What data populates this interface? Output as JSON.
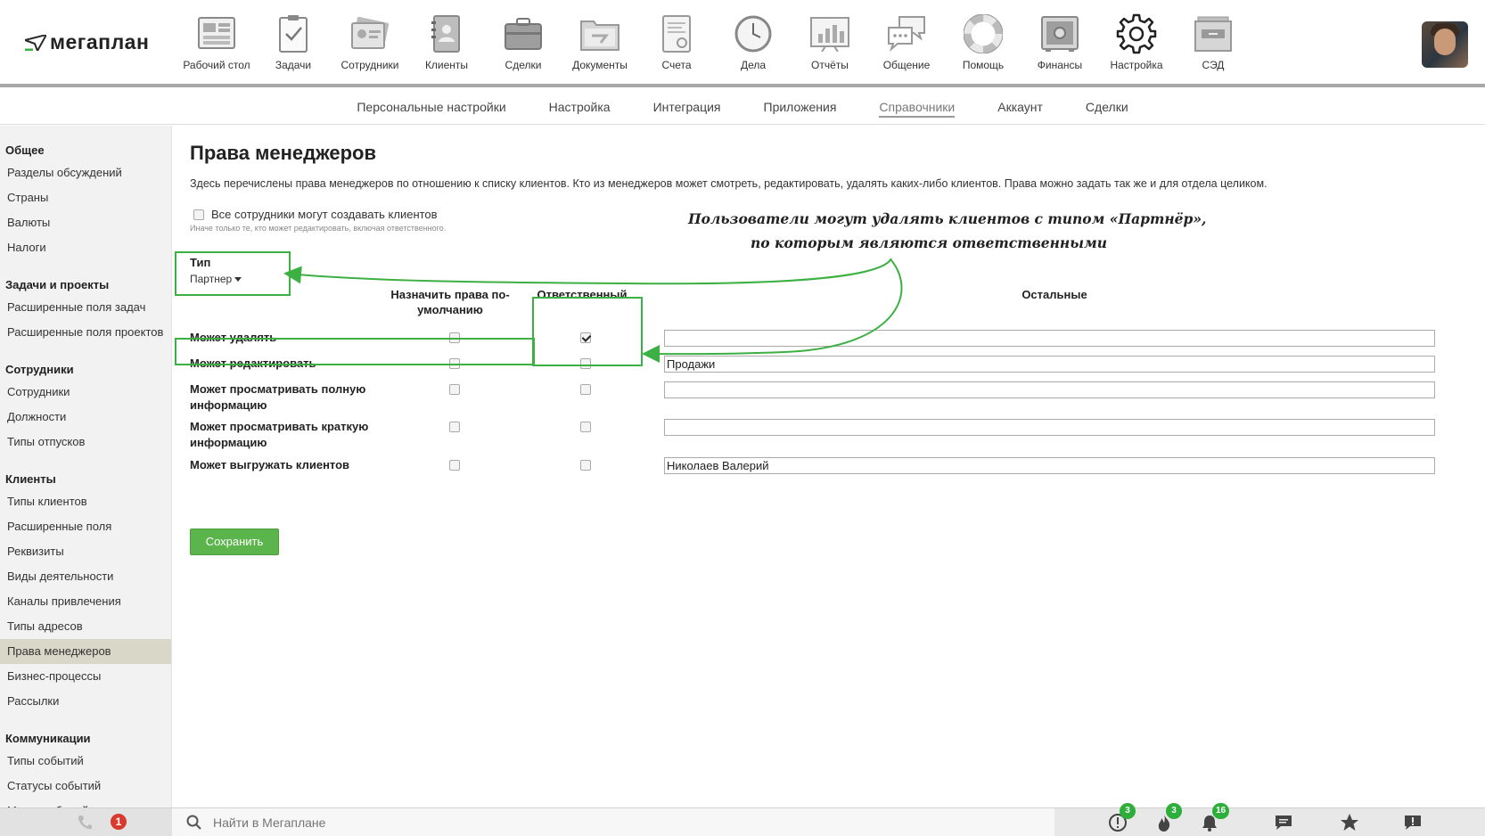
{
  "logo": {
    "text": "мегаплан"
  },
  "nav": [
    {
      "label": "Рабочий стол",
      "icon": "desktop-icon"
    },
    {
      "label": "Задачи",
      "icon": "tasks-icon"
    },
    {
      "label": "Сотрудники",
      "icon": "employees-icon"
    },
    {
      "label": "Клиенты",
      "icon": "clients-icon"
    },
    {
      "label": "Сделки",
      "icon": "deals-icon"
    },
    {
      "label": "Документы",
      "icon": "documents-icon"
    },
    {
      "label": "Счета",
      "icon": "invoices-icon"
    },
    {
      "label": "Дела",
      "icon": "todo-clock-icon"
    },
    {
      "label": "Отчёты",
      "icon": "reports-icon"
    },
    {
      "label": "Общение",
      "icon": "chat-icon"
    },
    {
      "label": "Помощь",
      "icon": "lifebuoy-icon"
    },
    {
      "label": "Финансы",
      "icon": "safe-icon"
    },
    {
      "label": "Настройка",
      "icon": "gear-icon"
    },
    {
      "label": "СЭД",
      "icon": "archive-icon"
    }
  ],
  "subtabs": [
    {
      "label": "Персональные настройки",
      "active": false
    },
    {
      "label": "Настройка",
      "active": false
    },
    {
      "label": "Интеграция",
      "active": false
    },
    {
      "label": "Приложения",
      "active": false
    },
    {
      "label": "Справочники",
      "active": true
    },
    {
      "label": "Аккаунт",
      "active": false
    },
    {
      "label": "Сделки",
      "active": false
    }
  ],
  "sidebar": {
    "groups": [
      {
        "title": "Общее",
        "items": [
          "Разделы обсуждений",
          "Страны",
          "Валюты",
          "Налоги"
        ]
      },
      {
        "title": "Задачи и проекты",
        "items": [
          "Расширенные поля задач",
          "Расширенные поля проектов"
        ]
      },
      {
        "title": "Сотрудники",
        "items": [
          "Сотрудники",
          "Должности",
          "Типы отпусков"
        ]
      },
      {
        "title": "Клиенты",
        "items": [
          "Типы клиентов",
          "Расширенные поля",
          "Реквизиты",
          "Виды деятельности",
          "Каналы привлечения",
          "Типы адресов",
          "Права менеджеров",
          "Бизнес-процессы",
          "Рассылки"
        ]
      },
      {
        "title": "Коммуникации",
        "items": [
          "Типы событий",
          "Статусы событий",
          "Метки событий"
        ]
      }
    ],
    "active_item": "Права менеджеров"
  },
  "main": {
    "title": "Права менеджеров",
    "description": "Здесь перечислены права менеджеров по отношению к списку клиентов. Кто из менеджеров может смотреть, редактировать, удалять каких-либо клиентов. Права можно задать так же и для отдела целиком.",
    "all_can_create": {
      "label": "Все сотрудники могут создавать клиентов",
      "checked": false,
      "hint": "Иначе только те, кто может редактировать, включая ответственного."
    },
    "type": {
      "label": "Тип",
      "value": "Партнер"
    },
    "columns": {
      "default": "Назначить права по-умолчанию",
      "responsible": "Ответственный",
      "others": "Остальные"
    },
    "permissions": [
      {
        "label": "Может удалять",
        "default": false,
        "responsible": true,
        "others": ""
      },
      {
        "label": "Может редактировать",
        "default": false,
        "responsible": false,
        "others": "Продажи"
      },
      {
        "label": "Может просматривать полную информацию",
        "default": false,
        "responsible": false,
        "others": ""
      },
      {
        "label": "Может просматривать краткую информацию",
        "default": false,
        "responsible": false,
        "others": ""
      },
      {
        "label": "Может выгружать клиентов",
        "default": false,
        "responsible": false,
        "others": "Николаев Валерий"
      }
    ],
    "save_label": "Сохранить"
  },
  "annotation": {
    "line1": "Пользователи могут удалять клиентов с типом «Партнёр»,",
    "line2": "по которым являются ответственными",
    "color": "#3cb043"
  },
  "bottombar": {
    "search_placeholder": "Найти в Мегаплане",
    "phone_badge": "1",
    "alerts_badge": "3",
    "fire_badge": "3",
    "bell_badge": "16"
  }
}
